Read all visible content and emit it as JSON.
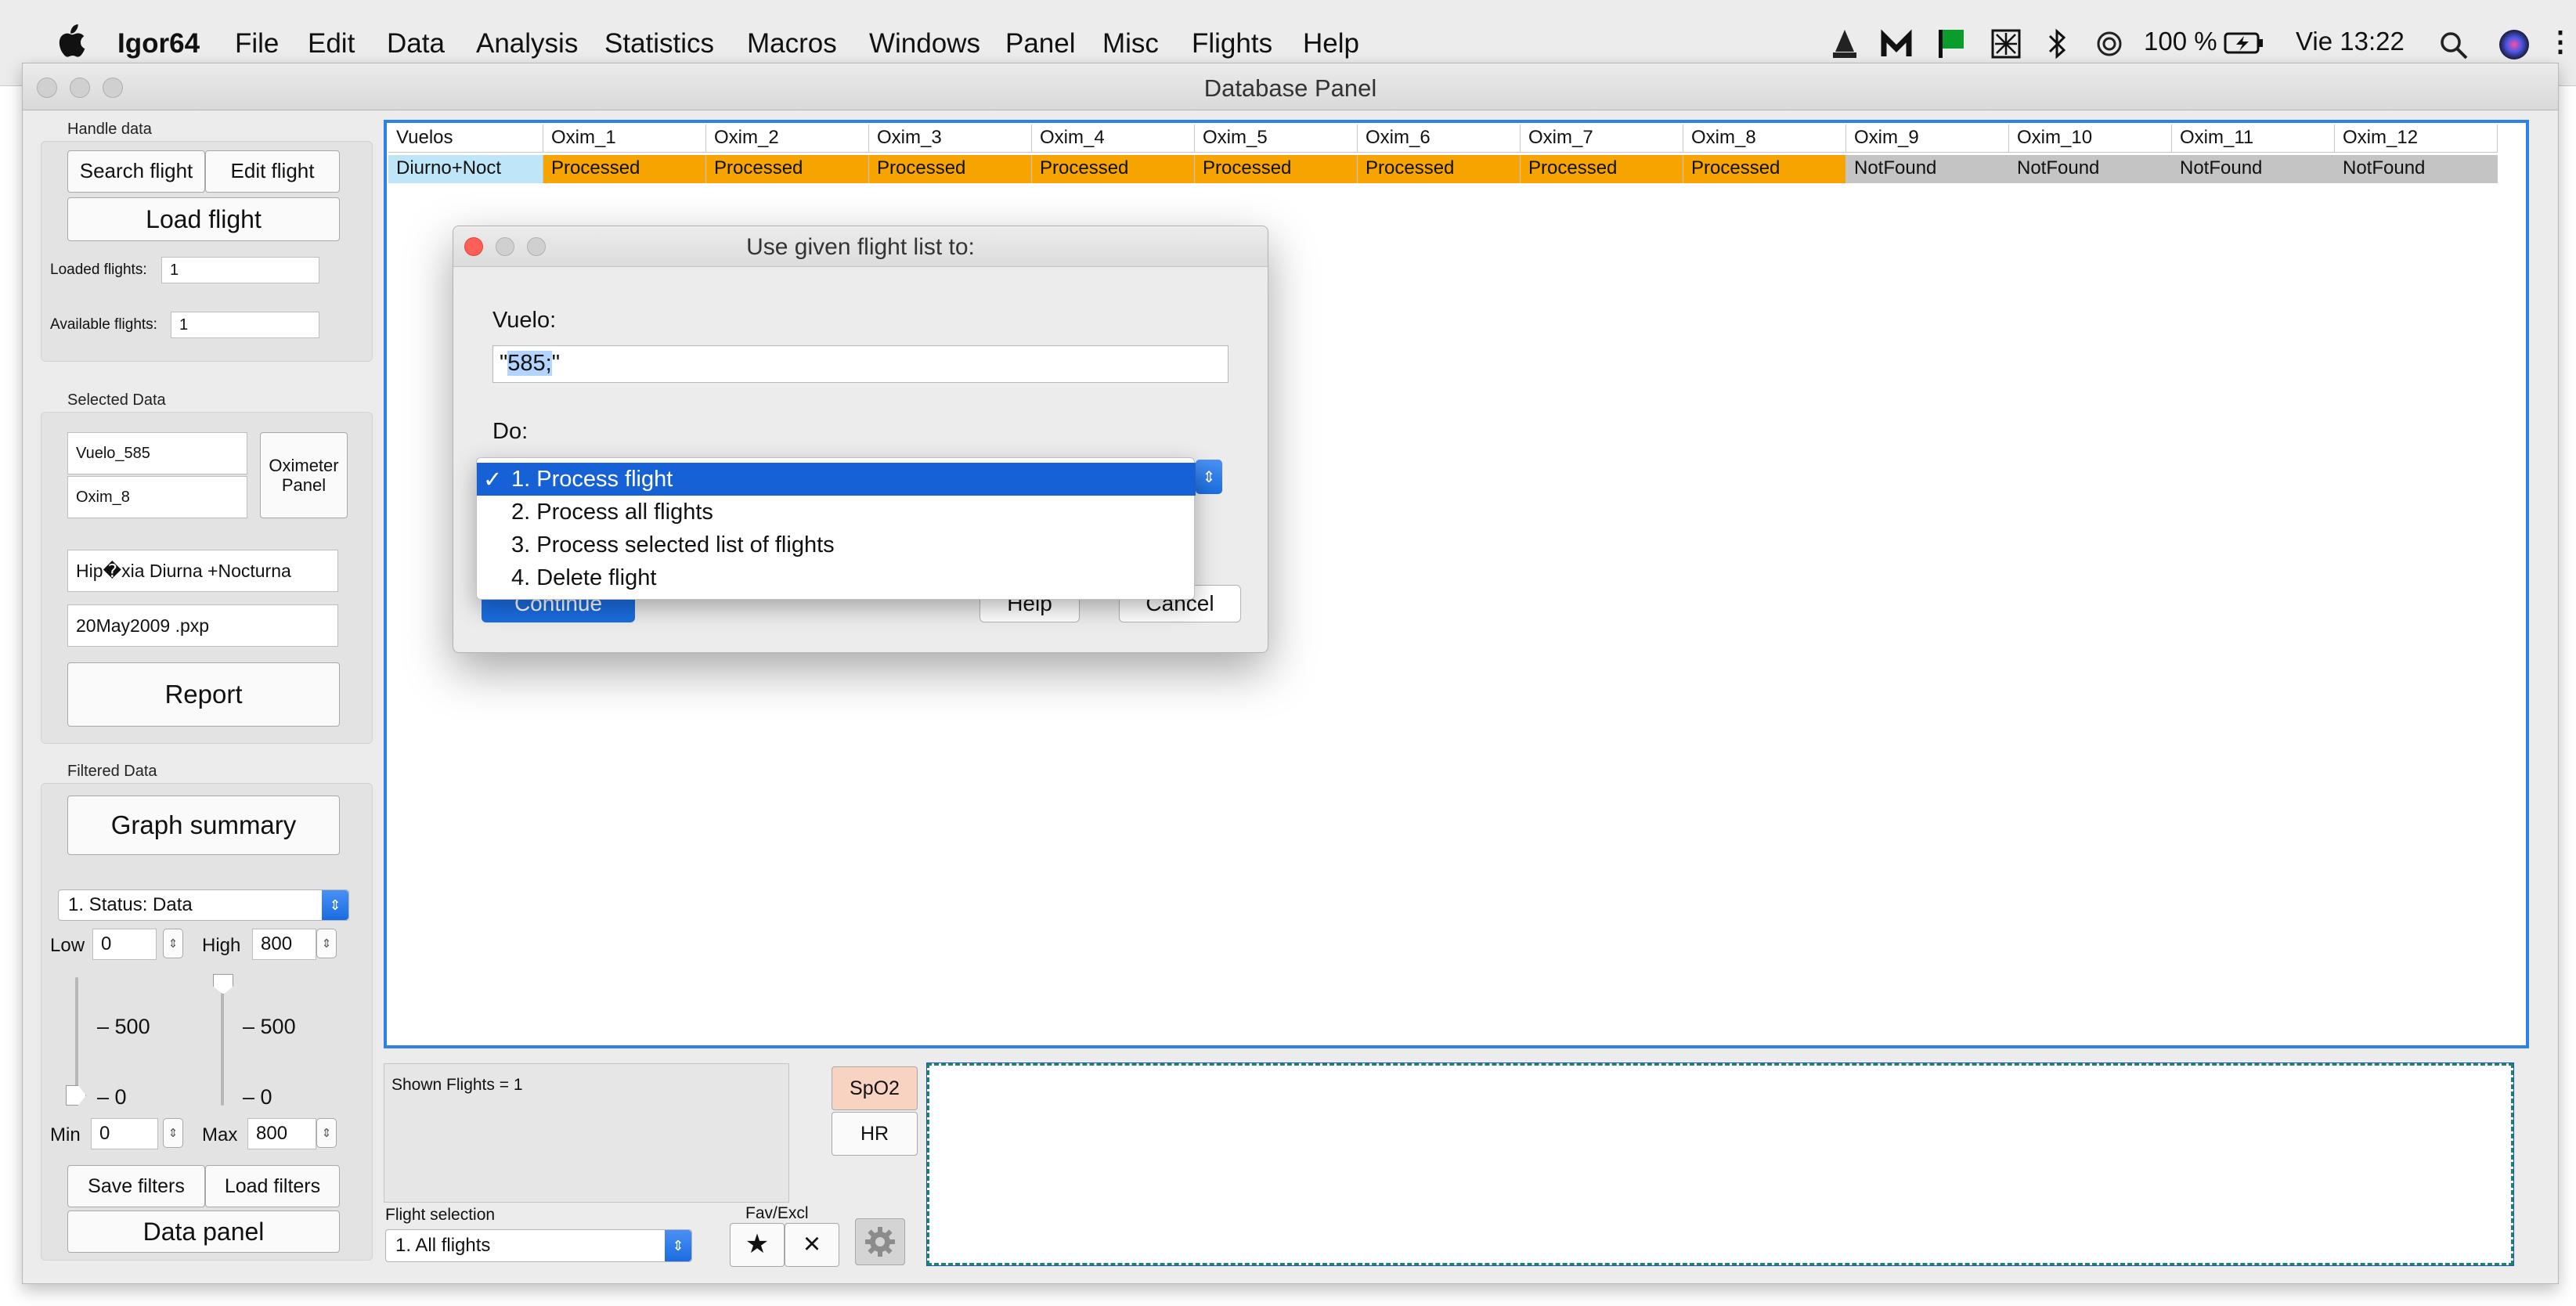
{
  "menubar": {
    "app_name": "Igor64",
    "items": [
      "File",
      "Edit",
      "Data",
      "Analysis",
      "Statistics",
      "Macros",
      "Windows",
      "Panel",
      "Misc",
      "Flights",
      "Help"
    ],
    "battery": "100 %",
    "clock": "Vie 13:22"
  },
  "window": {
    "title": "Database Panel"
  },
  "handle_data": {
    "label": "Handle data",
    "search_flight": "Search flight",
    "edit_flight": "Edit flight",
    "load_flight": "Load flight",
    "loaded_label": "Loaded flights:",
    "loaded_value": "1",
    "available_label": "Available flights:",
    "available_value": "1"
  },
  "selected_data": {
    "label": "Selected Data",
    "flight_field": "Vuelo_585",
    "oximeter_field": "Oxim_8",
    "oximeter_panel": "Oximeter Panel",
    "condition_field": "Hip�xia Diurna +Nocturna",
    "file_field": "20May2009 .pxp",
    "report": "Report"
  },
  "filtered_data": {
    "label": "Filtered Data",
    "graph_summary": "Graph summary",
    "status_popup": "1. Status: Data",
    "low_label": "Low",
    "low_value": "0",
    "high_label": "High",
    "high_value": "800",
    "slider_left_mid": "500",
    "slider_left_low": "0",
    "slider_right_mid": "500",
    "slider_right_low": "0",
    "min_label": "Min",
    "min_value": "0",
    "max_label": "Max",
    "max_value": "800",
    "save_filters": "Save filters",
    "load_filters": "Load filters",
    "data_panel": "Data panel"
  },
  "table": {
    "columns": [
      "Vuelos",
      "Oxim_1",
      "Oxim_2",
      "Oxim_3",
      "Oxim_4",
      "Oxim_5",
      "Oxim_6",
      "Oxim_7",
      "Oxim_8",
      "Oxim_9",
      "Oxim_10",
      "Oxim_11",
      "Oxim_12"
    ],
    "row": [
      "Diurno+Noct",
      "Processed",
      "Processed",
      "Processed",
      "Processed",
      "Processed",
      "Processed",
      "Processed",
      "Processed",
      "NotFound",
      "NotFound",
      "NotFound",
      "NotFound"
    ],
    "colors": {
      "first": "#bfe6f8",
      "processed": "#f7a400",
      "notfound": "#c4c4c4"
    }
  },
  "dialog": {
    "title": "Use given flight list to:",
    "vuelo_label": "Vuelo:",
    "vuelo_prefix": "\"",
    "vuelo_selected": "585;",
    "vuelo_suffix": "\"",
    "do_label": "Do:",
    "options": [
      "1. Process flight",
      "2. Process all flights",
      "3. Process selected list of flights",
      "4. Delete flight"
    ],
    "checkmark": "✓",
    "continue": "Continue",
    "help": "Help",
    "cancel": "Cancel"
  },
  "bottom": {
    "shown_flights": "Shown Flights = 1",
    "spo2": "SpO2",
    "hr": "HR",
    "flight_selection_label": "Flight selection",
    "flight_selection_value": "1. All flights",
    "fav_excl_label": "Fav/Excl",
    "fav_symbol": "★",
    "excl_symbol": "×"
  },
  "icons": {
    "apple": "apple-icon",
    "settings": "gear-icon",
    "status": [
      "vlc-icon",
      "malwarebytes-icon",
      "flag-icon",
      "grid-icon",
      "bluetooth-icon",
      "airplay-icon",
      "battery-icon",
      "search-icon",
      "siri-icon"
    ]
  }
}
